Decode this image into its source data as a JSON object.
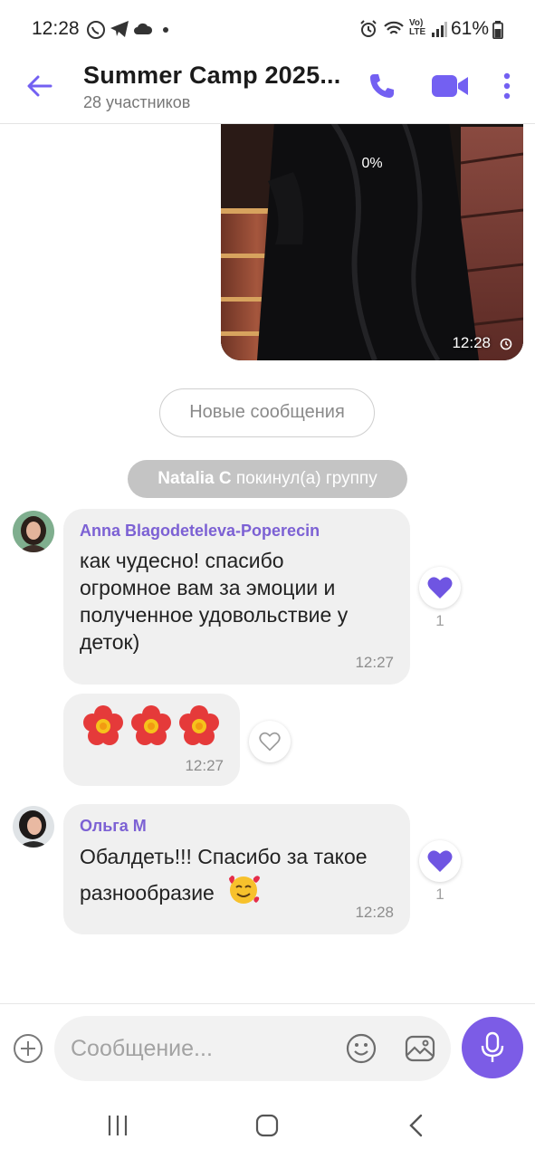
{
  "status_bar": {
    "time": "12:28",
    "battery": "61%",
    "network_label": "LTE"
  },
  "header": {
    "title": "Summer Camp 2025...",
    "subtitle": "28 участников"
  },
  "photo_message": {
    "progress": "0%",
    "time": "12:28"
  },
  "new_messages_label": "Новые сообщения",
  "system_message": {
    "name": "Natalia C",
    "text": " покинул(а) группу"
  },
  "messages": [
    {
      "sender": "Anna Blagodeteleva-Poperecin",
      "lines": [
        "как чудесно! спасибо",
        "огромное вам за эмоции и",
        "полученное удовольствие у",
        "деток)"
      ],
      "time": "12:27",
      "likes": "1",
      "liked": true
    },
    {
      "emoji": "🌺🌺🌺",
      "time": "12:27",
      "liked": false
    },
    {
      "sender": "Ольга М",
      "lines": [
        "Обалдеть!!! Спасибо за такое",
        "разнообразие"
      ],
      "time": "12:28",
      "likes": "1",
      "liked": true
    }
  ],
  "input": {
    "placeholder": "Сообщение..."
  },
  "colors": {
    "accent": "#7c5ce6",
    "sender_name": "#7c61d4",
    "bubble": "#f0f0f0"
  },
  "icons": [
    "back-arrow-icon",
    "phone-icon",
    "video-camera-icon",
    "more-vertical-icon",
    "plus-icon",
    "emoji-icon",
    "gallery-icon",
    "microphone-icon",
    "heart-icon",
    "clock-icon"
  ]
}
